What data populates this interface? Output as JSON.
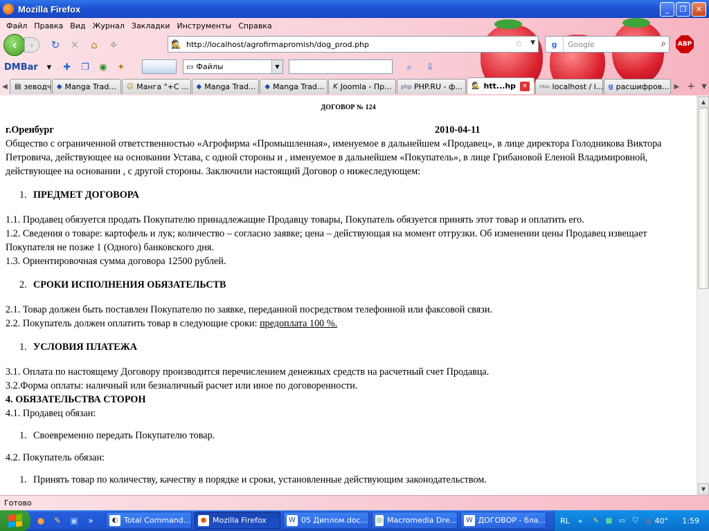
{
  "window": {
    "title": "Mozilla Firefox"
  },
  "menu": [
    "Файл",
    "Правка",
    "Вид",
    "Журнал",
    "Закладки",
    "Инструменты",
    "Справка"
  ],
  "nav": {
    "url": "http://localhost/agrofirmapromish/dog_prod.php",
    "search_placeholder": "Google",
    "search_engine": "g",
    "abp_label": "ABP"
  },
  "dmbar": {
    "label": "DMBar",
    "files_select": "Файлы"
  },
  "tabs": [
    {
      "label": "зеводчи...",
      "icon": "page-icon"
    },
    {
      "label": "Manga Trad...",
      "icon": "manga-icon"
    },
    {
      "label": "Манга \"+С ...",
      "icon": "smile-icon"
    },
    {
      "label": "Manga Trad...",
      "icon": "manga-icon"
    },
    {
      "label": "Manga Trad...",
      "icon": "manga-icon"
    },
    {
      "label": "Joomla - Пр...",
      "icon": "joomla-icon"
    },
    {
      "label": "PHP.RU - ф...",
      "icon": "php-icon"
    },
    {
      "label": "htt...hp",
      "icon": "spy-icon",
      "active": true
    },
    {
      "label": "localhost / l...",
      "icon": "pma-icon"
    },
    {
      "label": "расшифров...",
      "icon": "google-icon"
    }
  ],
  "doc": {
    "title": "ДОГОВОР № 124",
    "city": "г.Оренбург",
    "date": "2010-04-11",
    "intro": "Общество с ограниченной ответственностью «Агрофирма «Промышленная», именуемое в дальнейшем «Продавец», в лице директора Голодникова Виктора Петровича, действующее на основании Устава, с одной стороны и , именуемое в дальнейшем «Покупатель», в лице Грибановой Еленой Владимировной, действующее на основании , с другой стороны. Заключили настоящий Договор о нижеследующем:",
    "sec1_num": "1.",
    "sec1_title": "ПРЕДМЕТ ДОГОВОРА",
    "p1_1": "1.1. Продавец  обязуется продать Покупателю принадлежащие Продавцу товары, Покупатель обязуется принять этот товар и оплатить его.",
    "p1_2": "1.2.  Сведения о товаре: картофель и лук; количество – согласно заявке; цена – действующая на момент отгрузки. Об изменении цены Продавец извещает Покупателя не позже 1 (Одного) банковского дня.",
    "p1_3": "1.3. Ориентировочная сумма договора 12500 рублей.",
    "sec2_num": "2.",
    "sec2_title": "СРОКИ ИСПОЛНЕНИЯ ОБЯЗАТЕЛЬСТВ",
    "p2_1": "2.1. Товар  должен быть поставлен Покупателю по заявке, переданной посредством телефонной или факсовой связи.",
    "p2_2": "2.2. Покупатель должен оплатить товар в следующие сроки: ",
    "p2_2_terms": "предоплата 100 %.",
    "sec3_num": "1.",
    "sec3_title": "УСЛОВИЯ ПЛАТЕЖА",
    "p3_1": "3.1. Оплата по настоящему Договору  производится перечислением денежных средств на расчетный счет Продавца.",
    "p3_2": "3.2.Форма оплаты:  наличный или безналичный расчет или иное по договоренности.",
    "sec4_title": "4. ОБЯЗАТЕЛЬСТВА СТОРОН",
    "p4_1": "4.1. Продавец обязан:",
    "p4_1_item_num": "1.",
    "p4_1_item": "Своевременно передать Покупателю товар.",
    "p4_2": "4.2. Покупатель обязан:",
    "p4_2_item_num": "1.",
    "p4_2_item": "Принять товар по количеству, качеству в порядке и сроки, установленные действующим законодательством."
  },
  "status": "Готово",
  "taskbar": {
    "tasks": [
      {
        "label": "Total Command...",
        "icon": "tc-icon"
      },
      {
        "label": "Mozilla Firefox",
        "icon": "firefox-icon",
        "active": true
      },
      {
        "label": "05 Диплом.doc...",
        "icon": "word-icon"
      },
      {
        "label": "Macromedia Dre...",
        "icon": "dreamweaver-icon"
      },
      {
        "label": "ДОГОВОР - бла...",
        "icon": "word-icon"
      }
    ],
    "lang": "RL",
    "weather": "40°",
    "clock": "1:59"
  }
}
